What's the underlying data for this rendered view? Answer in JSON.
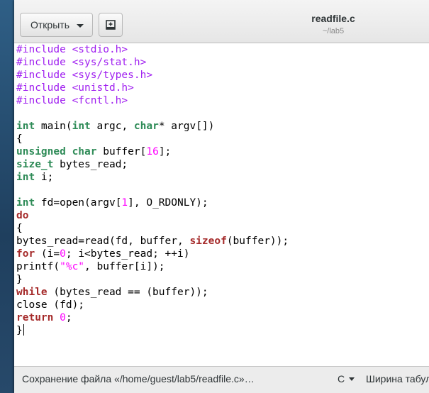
{
  "header": {
    "open_label": "Открыть",
    "title": "readfile.c",
    "subtitle": "~/lab5"
  },
  "status": {
    "message": "Сохранение файла «/home/guest/lab5/readfile.c»…",
    "language": "C",
    "tab_width": "Ширина табуляции"
  },
  "icons": {
    "open_menu": "chevron-down-icon",
    "new_document": "new-document-icon",
    "language_menu": "chevron-down-icon"
  },
  "colors": {
    "keyword": "#a52a2a",
    "type": "#2e8b57",
    "preprocessor": "#a020f0",
    "number": "#ff00ff"
  },
  "code": [
    [
      [
        "pp",
        "#include <stdio.h>"
      ]
    ],
    [
      [
        "pp",
        "#include <sys/stat.h>"
      ]
    ],
    [
      [
        "pp",
        "#include <sys/types.h>"
      ]
    ],
    [
      [
        "pp",
        "#include <unistd.h>"
      ]
    ],
    [
      [
        "pp",
        "#include <fcntl.h>"
      ]
    ],
    [],
    [
      [
        "ty",
        "int"
      ],
      [
        "",
        " main("
      ],
      [
        "ty",
        "int"
      ],
      [
        "",
        " argc, "
      ],
      [
        "ty",
        "char"
      ],
      [
        "",
        "* argv[])"
      ]
    ],
    [
      [
        "",
        "{"
      ]
    ],
    [
      [
        "ty",
        "unsigned char"
      ],
      [
        "",
        " buffer["
      ],
      [
        "num",
        "16"
      ],
      [
        "",
        "];"
      ]
    ],
    [
      [
        "ty",
        "size_t"
      ],
      [
        "",
        " bytes_read;"
      ]
    ],
    [
      [
        "ty",
        "int"
      ],
      [
        "",
        " i;"
      ]
    ],
    [],
    [
      [
        "ty",
        "int"
      ],
      [
        "",
        " fd=open(argv["
      ],
      [
        "num",
        "1"
      ],
      [
        "",
        "], O_RDONLY);"
      ]
    ],
    [
      [
        "kw",
        "do"
      ]
    ],
    [
      [
        "",
        "{"
      ]
    ],
    [
      [
        "",
        "bytes_read=read(fd, buffer, "
      ],
      [
        "kw",
        "sizeof"
      ],
      [
        "",
        "(buffer));"
      ]
    ],
    [
      [
        "kw",
        "for"
      ],
      [
        "",
        " (i="
      ],
      [
        "num",
        "0"
      ],
      [
        "",
        "; i<bytes_read; ++i)"
      ]
    ],
    [
      [
        "",
        "printf("
      ],
      [
        "num",
        "\"%c\""
      ],
      [
        "",
        ", buffer[i]);"
      ]
    ],
    [
      [
        "",
        "}"
      ]
    ],
    [
      [
        "kw",
        "while"
      ],
      [
        "",
        " (bytes_read == (buffer));"
      ]
    ],
    [
      [
        "",
        "close (fd);"
      ]
    ],
    [
      [
        "kw",
        "return"
      ],
      [
        "",
        " "
      ],
      [
        "num",
        "0"
      ],
      [
        "",
        ";"
      ]
    ],
    [
      [
        "",
        "}"
      ]
    ]
  ]
}
